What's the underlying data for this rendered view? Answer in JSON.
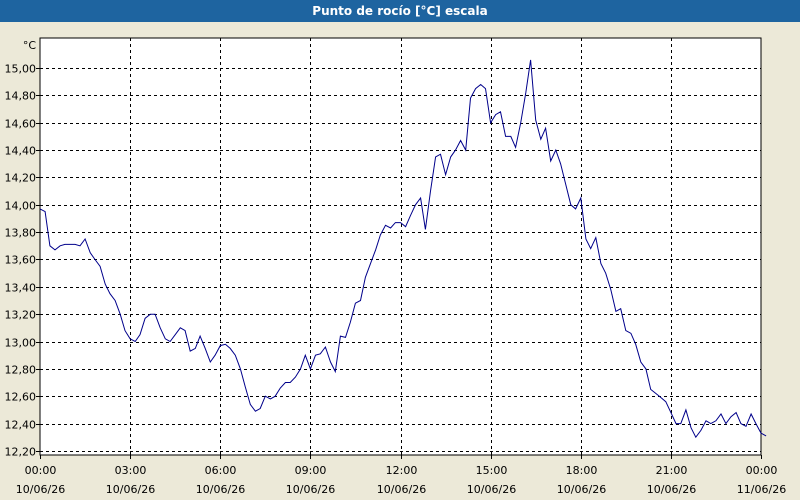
{
  "window": {
    "title": "Punto de rocío [°C] escala"
  },
  "colors": {
    "titlebar": "#1e64a0",
    "line": "#00008b",
    "plot_bg": "#ffffff",
    "panel_bg": "#ece9d8"
  },
  "chart_data": {
    "type": "line",
    "title": "Punto de rocío [°C] escala",
    "ylabel": "°C",
    "xlabel": "",
    "ylim": [
      12.17,
      15.22
    ],
    "xlim": [
      0,
      24
    ],
    "grid": true,
    "y_ticks": [
      "15,00",
      "14,80",
      "14,60",
      "14,40",
      "14,20",
      "14,00",
      "13,80",
      "13,60",
      "13,40",
      "13,20",
      "13,00",
      "12,80",
      "12,60",
      "12,40",
      "12,20"
    ],
    "y_tick_values": [
      15.0,
      14.8,
      14.6,
      14.4,
      14.2,
      14.0,
      13.8,
      13.6,
      13.4,
      13.2,
      13.0,
      12.8,
      12.6,
      12.4,
      12.2
    ],
    "x_ticks": [
      {
        "time": "00:00",
        "date": "10/06/26"
      },
      {
        "time": "03:00",
        "date": "10/06/26"
      },
      {
        "time": "06:00",
        "date": "10/06/26"
      },
      {
        "time": "09:00",
        "date": "10/06/26"
      },
      {
        "time": "12:00",
        "date": "10/06/26"
      },
      {
        "time": "15:00",
        "date": "10/06/26"
      },
      {
        "time": "18:00",
        "date": "10/06/26"
      },
      {
        "time": "21:00",
        "date": "10/06/26"
      },
      {
        "time": "00:00",
        "date": "11/06/26"
      }
    ],
    "x_tick_hours": [
      0,
      3,
      6,
      9,
      12,
      15,
      18,
      21,
      24
    ],
    "series": [
      {
        "values": [
          [
            0.0,
            13.97
          ],
          [
            0.17,
            13.95
          ],
          [
            0.33,
            13.7
          ],
          [
            0.5,
            13.67
          ],
          [
            0.67,
            13.7
          ],
          [
            0.83,
            13.71
          ],
          [
            1.0,
            13.71
          ],
          [
            1.17,
            13.71
          ],
          [
            1.33,
            13.7
          ],
          [
            1.5,
            13.75
          ],
          [
            1.67,
            13.65
          ],
          [
            1.83,
            13.6
          ],
          [
            2.0,
            13.55
          ],
          [
            2.17,
            13.42
          ],
          [
            2.33,
            13.35
          ],
          [
            2.5,
            13.3
          ],
          [
            2.67,
            13.2
          ],
          [
            2.83,
            13.08
          ],
          [
            3.0,
            13.02
          ],
          [
            3.17,
            13.0
          ],
          [
            3.33,
            13.05
          ],
          [
            3.5,
            13.17
          ],
          [
            3.67,
            13.2
          ],
          [
            3.83,
            13.2
          ],
          [
            4.0,
            13.1
          ],
          [
            4.17,
            13.02
          ],
          [
            4.33,
            13.0
          ],
          [
            4.5,
            13.05
          ],
          [
            4.67,
            13.1
          ],
          [
            4.83,
            13.08
          ],
          [
            5.0,
            12.93
          ],
          [
            5.17,
            12.95
          ],
          [
            5.33,
            13.04
          ],
          [
            5.5,
            12.95
          ],
          [
            5.67,
            12.85
          ],
          [
            5.83,
            12.9
          ],
          [
            6.0,
            12.97
          ],
          [
            6.17,
            12.98
          ],
          [
            6.33,
            12.95
          ],
          [
            6.5,
            12.9
          ],
          [
            6.67,
            12.8
          ],
          [
            6.83,
            12.67
          ],
          [
            7.0,
            12.54
          ],
          [
            7.17,
            12.49
          ],
          [
            7.33,
            12.51
          ],
          [
            7.5,
            12.6
          ],
          [
            7.67,
            12.58
          ],
          [
            7.83,
            12.6
          ],
          [
            8.0,
            12.66
          ],
          [
            8.17,
            12.7
          ],
          [
            8.33,
            12.7
          ],
          [
            8.5,
            12.74
          ],
          [
            8.67,
            12.8
          ],
          [
            8.83,
            12.9
          ],
          [
            9.0,
            12.8
          ],
          [
            9.17,
            12.9
          ],
          [
            9.33,
            12.91
          ],
          [
            9.5,
            12.96
          ],
          [
            9.67,
            12.85
          ],
          [
            9.83,
            12.78
          ],
          [
            10.0,
            13.04
          ],
          [
            10.17,
            13.03
          ],
          [
            10.33,
            13.14
          ],
          [
            10.5,
            13.28
          ],
          [
            10.67,
            13.3
          ],
          [
            10.83,
            13.47
          ],
          [
            11.0,
            13.57
          ],
          [
            11.17,
            13.67
          ],
          [
            11.33,
            13.78
          ],
          [
            11.5,
            13.85
          ],
          [
            11.67,
            13.83
          ],
          [
            11.83,
            13.87
          ],
          [
            12.0,
            13.87
          ],
          [
            12.17,
            13.84
          ],
          [
            12.33,
            13.92
          ],
          [
            12.5,
            14.0
          ],
          [
            12.67,
            14.05
          ],
          [
            12.83,
            13.82
          ],
          [
            13.0,
            14.1
          ],
          [
            13.17,
            14.35
          ],
          [
            13.33,
            14.37
          ],
          [
            13.5,
            14.22
          ],
          [
            13.67,
            14.35
          ],
          [
            13.83,
            14.4
          ],
          [
            14.0,
            14.47
          ],
          [
            14.17,
            14.4
          ],
          [
            14.33,
            14.78
          ],
          [
            14.5,
            14.85
          ],
          [
            14.67,
            14.88
          ],
          [
            14.83,
            14.85
          ],
          [
            15.0,
            14.6
          ],
          [
            15.17,
            14.66
          ],
          [
            15.33,
            14.68
          ],
          [
            15.5,
            14.5
          ],
          [
            15.67,
            14.5
          ],
          [
            15.83,
            14.42
          ],
          [
            16.0,
            14.6
          ],
          [
            16.17,
            14.82
          ],
          [
            16.33,
            15.06
          ],
          [
            16.5,
            14.62
          ],
          [
            16.67,
            14.48
          ],
          [
            16.83,
            14.56
          ],
          [
            17.0,
            14.32
          ],
          [
            17.17,
            14.4
          ],
          [
            17.33,
            14.3
          ],
          [
            17.5,
            14.15
          ],
          [
            17.67,
            14.0
          ],
          [
            17.83,
            13.97
          ],
          [
            18.0,
            14.05
          ],
          [
            18.17,
            13.75
          ],
          [
            18.33,
            13.68
          ],
          [
            18.5,
            13.76
          ],
          [
            18.67,
            13.57
          ],
          [
            18.83,
            13.5
          ],
          [
            19.0,
            13.38
          ],
          [
            19.17,
            13.22
          ],
          [
            19.33,
            13.24
          ],
          [
            19.5,
            13.08
          ],
          [
            19.67,
            13.06
          ],
          [
            19.83,
            12.98
          ],
          [
            20.0,
            12.85
          ],
          [
            20.17,
            12.8
          ],
          [
            20.33,
            12.65
          ],
          [
            20.5,
            12.62
          ],
          [
            20.67,
            12.59
          ],
          [
            20.83,
            12.56
          ],
          [
            21.0,
            12.48
          ],
          [
            21.17,
            12.4
          ],
          [
            21.33,
            12.4
          ],
          [
            21.5,
            12.5
          ],
          [
            21.67,
            12.37
          ],
          [
            21.83,
            12.3
          ],
          [
            22.0,
            12.35
          ],
          [
            22.17,
            12.42
          ],
          [
            22.33,
            12.4
          ],
          [
            22.5,
            12.42
          ],
          [
            22.67,
            12.47
          ],
          [
            22.83,
            12.4
          ],
          [
            23.0,
            12.45
          ],
          [
            23.17,
            12.48
          ],
          [
            23.33,
            12.4
          ],
          [
            23.5,
            12.38
          ],
          [
            23.67,
            12.47
          ],
          [
            23.83,
            12.4
          ],
          [
            24.0,
            12.33
          ],
          [
            24.17,
            12.31
          ]
        ]
      }
    ]
  }
}
